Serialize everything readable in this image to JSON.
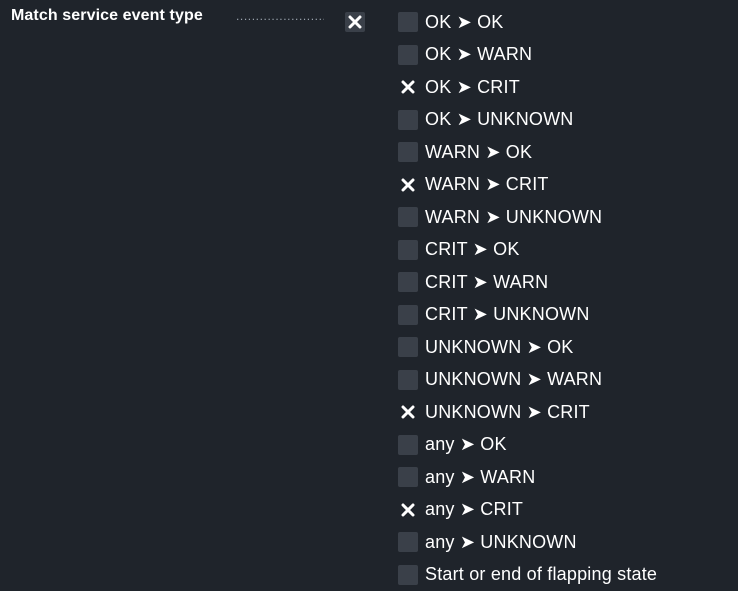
{
  "field": {
    "label": "Match service event type",
    "dots": "....................................",
    "master_checked": true
  },
  "options": [
    {
      "label": "OK ➤ OK",
      "checked": false
    },
    {
      "label": "OK ➤ WARN",
      "checked": false
    },
    {
      "label": "OK ➤ CRIT",
      "checked": true
    },
    {
      "label": "OK ➤ UNKNOWN",
      "checked": false
    },
    {
      "label": "WARN ➤ OK",
      "checked": false
    },
    {
      "label": "WARN ➤ CRIT",
      "checked": true
    },
    {
      "label": "WARN ➤ UNKNOWN",
      "checked": false
    },
    {
      "label": "CRIT ➤ OK",
      "checked": false
    },
    {
      "label": "CRIT ➤ WARN",
      "checked": false
    },
    {
      "label": "CRIT ➤ UNKNOWN",
      "checked": false
    },
    {
      "label": "UNKNOWN ➤ OK",
      "checked": false
    },
    {
      "label": "UNKNOWN ➤ WARN",
      "checked": false
    },
    {
      "label": "UNKNOWN ➤ CRIT",
      "checked": true
    },
    {
      "label": "any ➤ OK",
      "checked": false
    },
    {
      "label": "any ➤ WARN",
      "checked": false
    },
    {
      "label": "any ➤ CRIT",
      "checked": true
    },
    {
      "label": "any ➤ UNKNOWN",
      "checked": false
    },
    {
      "label": "Start or end of flapping state",
      "checked": false
    }
  ],
  "colors": {
    "background": "#1f242b",
    "checkbox": "#3a4049",
    "text": "#ffffff"
  },
  "icons": {
    "checkmark": "x-mark-icon"
  }
}
